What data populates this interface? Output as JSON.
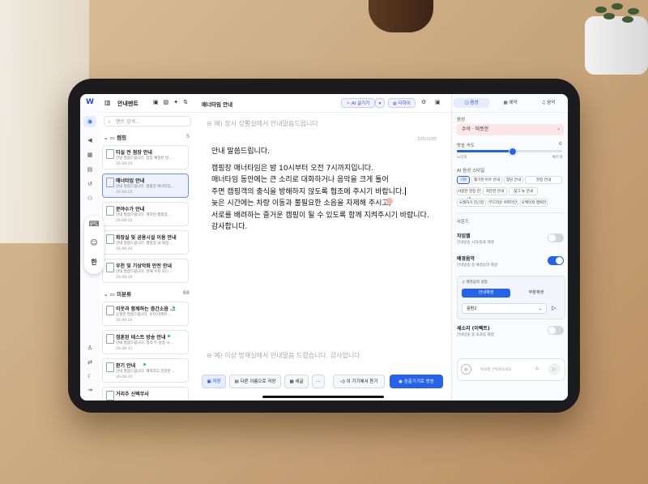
{
  "app": {
    "logo": "W"
  },
  "rail": {
    "icons": [
      "broadcast-icon",
      "megaphone-icon",
      "calendar-icon",
      "database-icon",
      "history-icon",
      "people-icon",
      "user-icon",
      "translate-icon",
      "moon-icon",
      "logout-icon"
    ]
  },
  "list": {
    "title": "안내멘트",
    "tools": [
      "doc-plus-icon",
      "folder-plus-icon",
      "magic-icon",
      "sort-icon"
    ],
    "search_placeholder": "멘트 검색...",
    "groups": [
      {
        "name": "캠핑",
        "count": "5",
        "items": [
          {
            "title": "티실 전 점장 안내",
            "desc": "안녕 말씀드립니다. 잠장 예정된 방...",
            "date": "26-08-20",
            "selected": false
          },
          {
            "title": "매너타임 안내",
            "desc": "안내 말씀드립니다. 캠핑장 매너타임...",
            "date": "26-08-20",
            "selected": true
          },
          {
            "title": "분야수가 안내",
            "desc": "안내 말씀드립니다. 캐치된 캠핑장...",
            "date": "26-08-20",
            "selected": false
          },
          {
            "title": "화장실 및 공용시설 이용 안내",
            "desc": "안내 말씀드립니다. 캠핑장 내 화장...",
            "date": "26-08-20",
            "selected": false
          },
          {
            "title": "우천 및 기상악화 안전 안내",
            "desc": "안내 말씀드립니다. 현재 우천 또는...",
            "date": "26-08-20",
            "selected": false
          }
        ]
      },
      {
        "name": "미분류",
        "count": "88",
        "items": [
          {
            "title": "이웃과 함께하는 층간소음 ...",
            "desc": "공생한 말씀드립니다. 우리 아파트...",
            "date": "26-08-20",
            "selected": false
          },
          {
            "title": "정훈된 테스트 방송 안내",
            "desc": "안내 말씀드립니다. 정각 두 방송 시...",
            "date": "26-08-11",
            "selected": false
          },
          {
            "title": "환기 안내",
            "desc": "안내 말씀드립니다. 쾌적하고 건강한...",
            "date": "26-08-20",
            "selected": false
          },
          {
            "title": "거리주 신택무사",
            "desc": "",
            "date": "",
            "selected": false
          }
        ]
      }
    ]
  },
  "fab": {
    "icons": [
      "keyboard-icon",
      "emoji-icon"
    ],
    "lang": "한"
  },
  "editor": {
    "title": "매너타임 안내",
    "ai_label": "AI 글기기",
    "ai_dropdown": "▾",
    "theme_label": "더하이",
    "top_prompt": "예) 장시 상황실에서 안내말씀드립니다",
    "counter": "105/1000",
    "lines": [
      "안내 말씀드립니다.",
      "",
      "캠핑장 매너타임은 밤 10시부터 오전 7시까지입니다.",
      "매너타임 동안에는 큰 소리로 대화하거나 음악을 크게 틀어",
      "주면 캠핑객의 충식을 방해하지 않도록 협조에 주시기 바랍니다.",
      "늦은 시간에는 차량 이동과 불필요한 소음을 자제해 주시고,",
      "서로를 배려하는 즐거운 캠핑이 될 수 있도록 함께 지켜주시기 바랍니다.",
      "감사합니다."
    ],
    "bottom_prompt": "예) 이상 방재실에서 안내말씀 드렸습니다. 감사합니다",
    "buttons": {
      "save": "저장",
      "save_as": "다른 이름으로 저장",
      "format": "세글",
      "more": "⋯",
      "listen": "이 기기에서 듣기",
      "broadcast": "송출기기로 방송"
    }
  },
  "panel": {
    "tabs": [
      "음성",
      "예약",
      "음악"
    ],
    "voice_label": "음성",
    "voice_value": "수아 · 따뜻한",
    "speed_label": "방송 속도",
    "speed_value": "0",
    "speed_fraction": 0.52,
    "speed_min": "느리게",
    "speed_max": "빠르게",
    "style_label": "AI 음성 스타일",
    "styles": [
      "기본",
      "활기찬 아트 안내",
      "정당 안내",
      "현장 안내",
      "사랑한 현장 안내",
      "차분한 안내",
      "찾그 뉴 안내",
      "오래하기 친근함",
      "부드러운 아파리안",
      "오케이적 행복한",
      "차지오는 안내"
    ],
    "sound_label": "사운드",
    "chime": {
      "title": "차임벨",
      "desc": "안내방송 시작/종료 재생",
      "on": false
    },
    "bgm": {
      "title": "배경음악",
      "desc": "안내방송 중 배경음악 재생",
      "on": true
    },
    "bgm_settings": {
      "header": "배경음악 설정",
      "mode_on": "안내재생",
      "mode_off": "부분재생",
      "track": "몽환2",
      "chevron": "⌄",
      "play": "▷"
    },
    "effect": {
      "title": "세소리 (이펙트)",
      "desc": "안내방송 중 효과음 재생",
      "on": false
    },
    "compose_placeholder": "메세를 선택해보세요",
    "compose_icon": "mic-icon"
  }
}
